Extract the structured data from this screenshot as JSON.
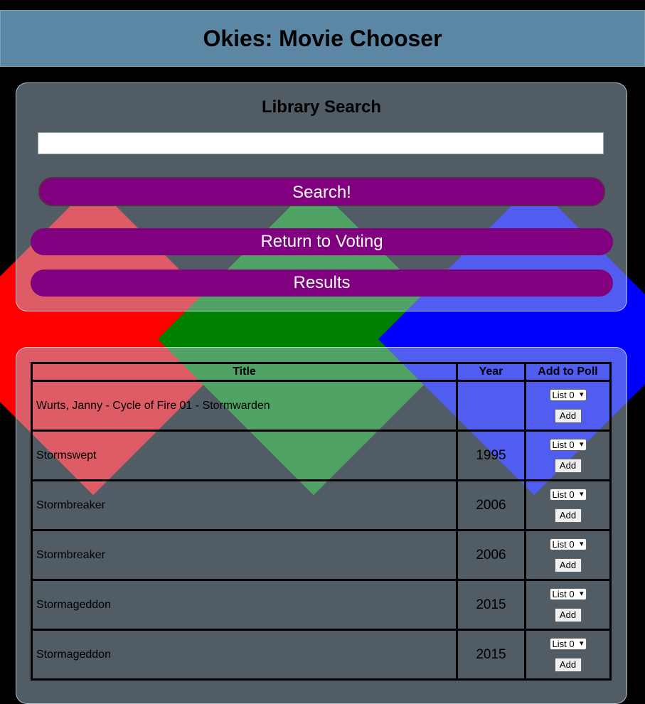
{
  "app": {
    "title": "Okies: Movie Chooser"
  },
  "search": {
    "heading": "Library Search",
    "input_value": "",
    "search_label": "Search!",
    "return_label": "Return to Voting",
    "results_label": "Results"
  },
  "table": {
    "headers": [
      "Title",
      "Year",
      "Add to Poll"
    ],
    "rows": [
      {
        "title": "Wurts, Janny - Cycle of Fire 01 - Stormwarden",
        "year": "",
        "list": "List 0",
        "add": "Add"
      },
      {
        "title": "Stormswept",
        "year": "1995",
        "list": "List 0",
        "add": "Add"
      },
      {
        "title": "Stormbreaker",
        "year": "2006",
        "list": "List 0",
        "add": "Add"
      },
      {
        "title": "Stormbreaker",
        "year": "2006",
        "list": "List 0",
        "add": "Add"
      },
      {
        "title": "Stormageddon",
        "year": "2015",
        "list": "List 0",
        "add": "Add"
      },
      {
        "title": "Stormageddon",
        "year": "2015",
        "list": "List 0",
        "add": "Add"
      }
    ]
  },
  "colors": {
    "header_bg": "#5b87a5",
    "button": "#800080",
    "diamond_red": "#ff0000",
    "diamond_green": "#008000",
    "diamond_blue": "#0000ff"
  }
}
